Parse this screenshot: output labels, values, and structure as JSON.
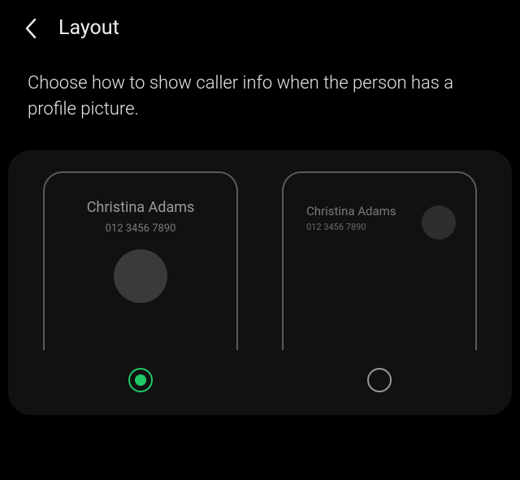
{
  "header": {
    "title": "Layout"
  },
  "description": "Choose how to show caller info when the person has a profile picture.",
  "preview": {
    "caller_name": "Christina Adams",
    "caller_number": "012 3456 7890"
  },
  "options": [
    {
      "id": "centered",
      "selected": true
    },
    {
      "id": "compact",
      "selected": false
    }
  ],
  "colors": {
    "accent": "#1fc966",
    "background": "#000000",
    "panel": "#111111"
  }
}
